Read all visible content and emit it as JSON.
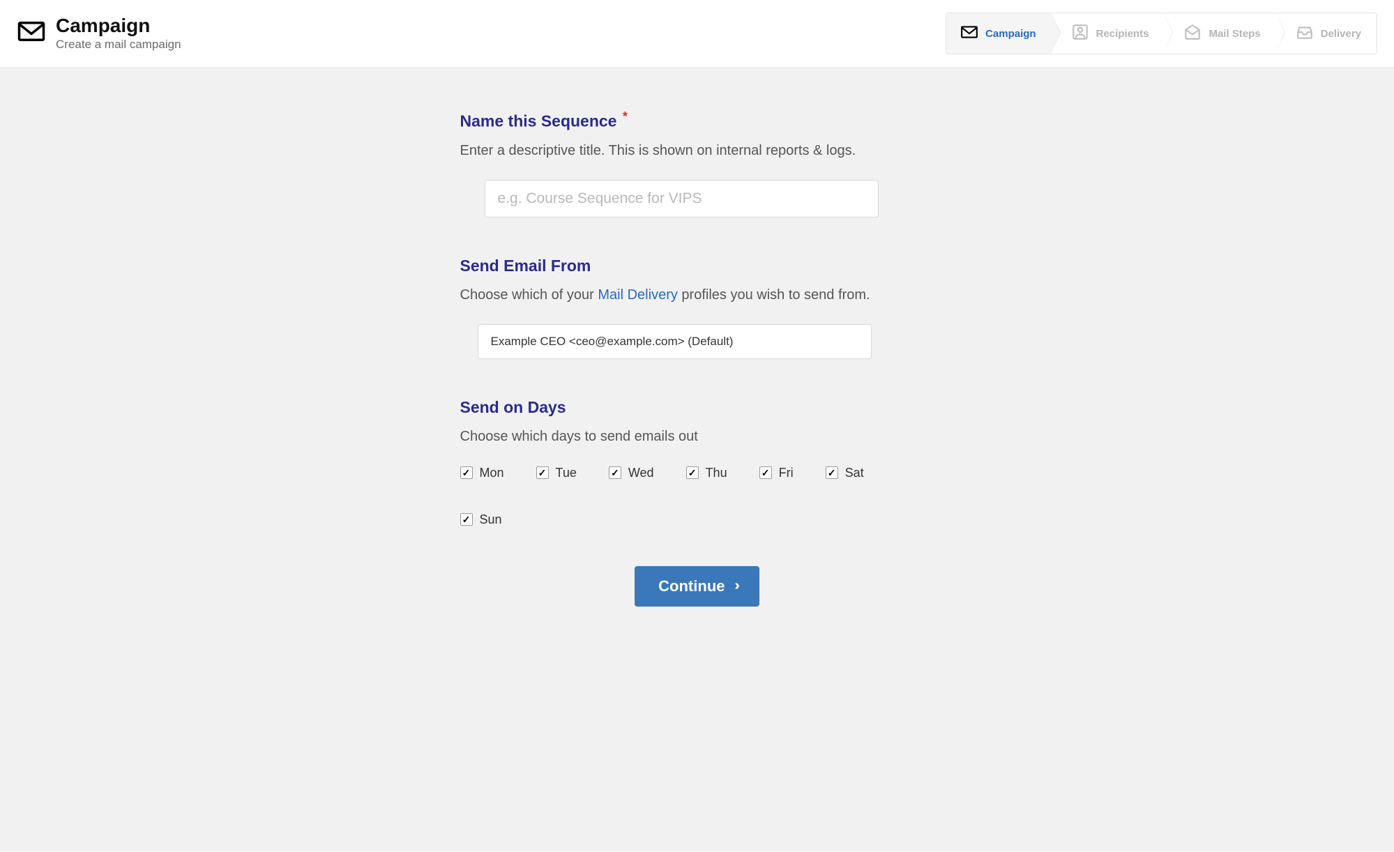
{
  "header": {
    "title": "Campaign",
    "subtitle": "Create a mail campaign"
  },
  "stepper": {
    "steps": [
      {
        "label": "Campaign",
        "active": true
      },
      {
        "label": "Recipients",
        "active": false
      },
      {
        "label": "Mail Steps",
        "active": false
      },
      {
        "label": "Delivery",
        "active": false
      }
    ]
  },
  "sections": {
    "name": {
      "title": "Name this Sequence",
      "required": "*",
      "desc": "Enter a descriptive title. This is shown on internal reports & logs.",
      "placeholder": "e.g. Course Sequence for VIPS"
    },
    "from": {
      "title": "Send Email From",
      "desc_prefix": "Choose which of your ",
      "desc_link": "Mail Delivery",
      "desc_suffix": " profiles you wish to send from.",
      "selected": "Example CEO <ceo@example.com> (Default)"
    },
    "days": {
      "title": "Send on Days",
      "desc": "Choose which days to send emails out",
      "items": [
        {
          "label": "Mon",
          "checked": true
        },
        {
          "label": "Tue",
          "checked": true
        },
        {
          "label": "Wed",
          "checked": true
        },
        {
          "label": "Thu",
          "checked": true
        },
        {
          "label": "Fri",
          "checked": true
        },
        {
          "label": "Sat",
          "checked": true
        },
        {
          "label": "Sun",
          "checked": true
        }
      ]
    }
  },
  "actions": {
    "continue": "Continue"
  }
}
